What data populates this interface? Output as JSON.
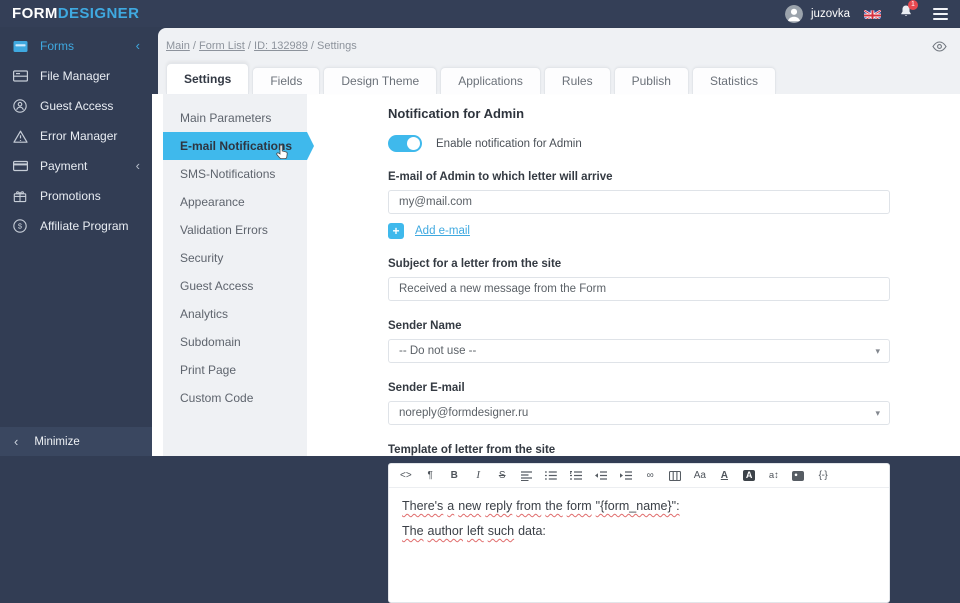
{
  "colors": {
    "accent": "#3fa9e0",
    "submenu_active": "#3fb9ec",
    "sidebar_bg": "#323d54",
    "notification_badge": "#e8484f"
  },
  "glyphs": {
    "chevron_left": "‹",
    "caret_down": "▾",
    "plus": "+"
  },
  "brand": {
    "part1": "FORM",
    "part2": "DESIGNER"
  },
  "header": {
    "username": "juzovka",
    "notification_count": "1"
  },
  "sidebar": {
    "items": [
      {
        "label": "Forms",
        "active": true,
        "has_submenu": true
      },
      {
        "label": "File Manager"
      },
      {
        "label": "Guest Access"
      },
      {
        "label": "Error Manager"
      },
      {
        "label": "Payment",
        "has_submenu": true
      },
      {
        "label": "Promotions"
      },
      {
        "label": "Affiliate Program"
      }
    ],
    "minimize": "Minimize"
  },
  "breadcrumb": [
    {
      "label": "Main",
      "link": true
    },
    {
      "label": "Form List",
      "link": true
    },
    {
      "label": "ID: 132989",
      "link": true
    },
    {
      "label": "Settings",
      "link": false
    }
  ],
  "tabs": [
    {
      "label": "Settings",
      "active": true
    },
    {
      "label": "Fields"
    },
    {
      "label": "Design Theme"
    },
    {
      "label": "Applications"
    },
    {
      "label": "Rules"
    },
    {
      "label": "Publish"
    },
    {
      "label": "Statistics"
    }
  ],
  "settings_menu": [
    {
      "label": "Main Parameters"
    },
    {
      "label": "E-mail Notifications",
      "active": true
    },
    {
      "label": "SMS-Notifications"
    },
    {
      "label": "Appearance"
    },
    {
      "label": "Validation Errors"
    },
    {
      "label": "Security"
    },
    {
      "label": "Guest Access"
    },
    {
      "label": "Analytics"
    },
    {
      "label": "Subdomain"
    },
    {
      "label": "Print Page"
    },
    {
      "label": "Custom Code"
    }
  ],
  "content": {
    "heading": "Notification for Admin",
    "toggle_label": "Enable notification for Admin",
    "toggle_on": true,
    "email_label": "E-mail of Admin to which letter will arrive",
    "email_value": "my@mail.com",
    "add_email_label": "Add e-mail",
    "subject_label": "Subject for a letter from the site",
    "subject_value": "Received a new message from the Form",
    "sender_name_label": "Sender Name",
    "sender_name_value": "-- Do not use --",
    "sender_email_label": "Sender E-mail",
    "sender_email_value": "noreply@formdesigner.ru",
    "template_label": "Template of letter from the site",
    "editor": {
      "toolbar": [
        {
          "name": "source-code",
          "glyph": "<>"
        },
        {
          "name": "paragraph",
          "glyph": "¶"
        },
        {
          "name": "bold",
          "glyph": "B"
        },
        {
          "name": "italic",
          "glyph": "I"
        },
        {
          "name": "strikethrough",
          "glyph": "S"
        },
        {
          "name": "align",
          "glyph": ""
        },
        {
          "name": "unordered-list",
          "glyph": ""
        },
        {
          "name": "ordered-list",
          "glyph": ""
        },
        {
          "name": "outdent",
          "glyph": ""
        },
        {
          "name": "indent",
          "glyph": ""
        },
        {
          "name": "link",
          "glyph": "∞"
        },
        {
          "name": "table",
          "glyph": ""
        },
        {
          "name": "font-size",
          "glyph": "Aa"
        },
        {
          "name": "text-color",
          "glyph": "A"
        },
        {
          "name": "background-color",
          "glyph": "A"
        },
        {
          "name": "line-height",
          "glyph": "a↕"
        },
        {
          "name": "image",
          "glyph": ""
        },
        {
          "name": "variables",
          "glyph": "{-}"
        }
      ],
      "lines": [
        {
          "words": [
            {
              "text": "There's",
              "misspelled": true
            },
            {
              "text": "a",
              "misspelled": true
            },
            {
              "text": "new",
              "misspelled": true
            },
            {
              "text": "reply",
              "misspelled": true
            },
            {
              "text": "from",
              "misspelled": true
            },
            {
              "text": "the",
              "misspelled": true
            },
            {
              "text": "form",
              "misspelled": true
            },
            {
              "text": "\"{form_name}\":",
              "misspelled": true
            }
          ]
        },
        {
          "words": [
            {
              "text": "The",
              "misspelled": true
            },
            {
              "text": "author",
              "misspelled": true
            },
            {
              "text": "left",
              "misspelled": true
            },
            {
              "text": "such",
              "misspelled": true
            },
            {
              "text": "data:",
              "misspelled": false
            }
          ]
        }
      ]
    }
  }
}
